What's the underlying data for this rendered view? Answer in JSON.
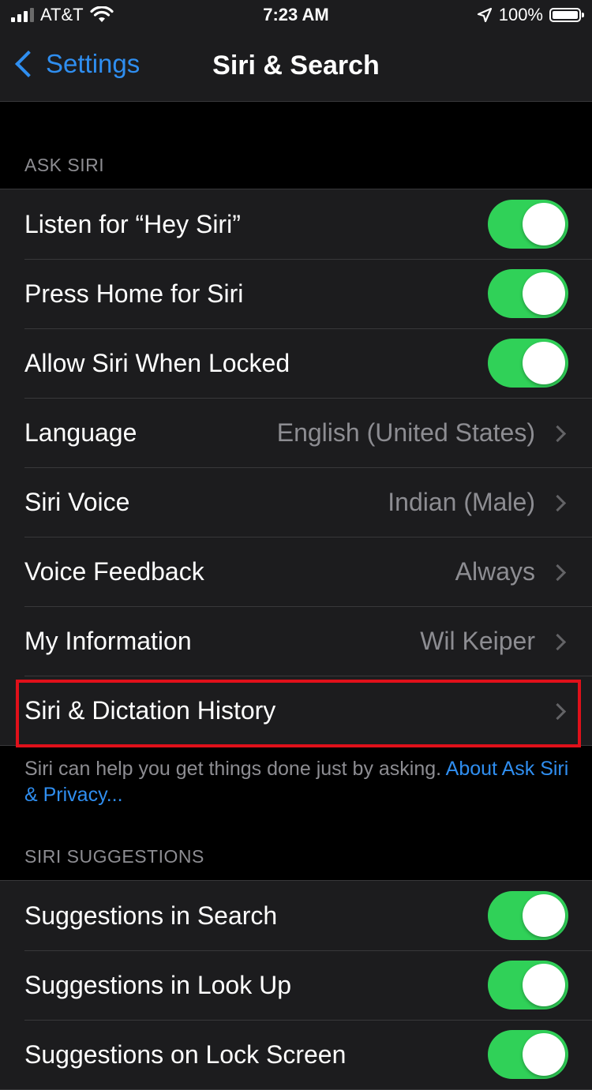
{
  "status_bar": {
    "carrier": "AT&T",
    "time": "7:23 AM",
    "battery": "100%"
  },
  "nav": {
    "back_label": "Settings",
    "title": "Siri & Search"
  },
  "ask_siri": {
    "header": "ASK SIRI",
    "rows": [
      {
        "label": "Listen for “Hey Siri”",
        "toggle": true
      },
      {
        "label": "Press Home for Siri",
        "toggle": true
      },
      {
        "label": "Allow Siri When Locked",
        "toggle": true
      },
      {
        "label": "Language",
        "value": "English (United States)"
      },
      {
        "label": "Siri Voice",
        "value": "Indian (Male)"
      },
      {
        "label": "Voice Feedback",
        "value": "Always"
      },
      {
        "label": "My Information",
        "value": "Wil Keiper"
      },
      {
        "label": "Siri & Dictation History",
        "value": ""
      }
    ],
    "footer": "Siri can help you get things done just by asking. ",
    "footer_link": "About Ask Siri & Privacy..."
  },
  "siri_suggestions": {
    "header": "SIRI SUGGESTIONS",
    "rows": [
      {
        "label": "Suggestions in Search",
        "toggle": true
      },
      {
        "label": "Suggestions in Look Up",
        "toggle": true
      },
      {
        "label": "Suggestions on Lock Screen",
        "toggle": true
      }
    ]
  },
  "colors": {
    "accent": "#2f8ef0",
    "toggle_on": "#30d158",
    "highlight": "#e0101a"
  }
}
